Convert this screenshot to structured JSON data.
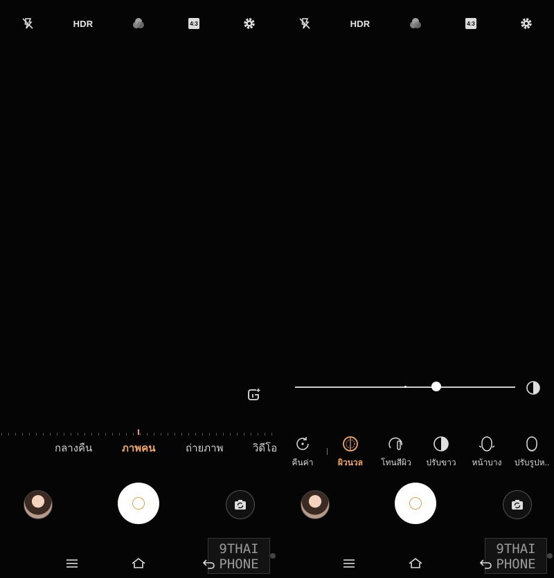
{
  "top_bar": {
    "items": [
      {
        "icon": "flash-off-icon"
      },
      {
        "label": "HDR"
      },
      {
        "icon": "filters-icon"
      },
      {
        "label": "4:3"
      },
      {
        "icon": "settings-gear-icon"
      }
    ]
  },
  "left": {
    "modes": [
      "กลางคืน",
      "ภาพคน",
      "ถ่ายภาพ",
      "วิดีโอ"
    ],
    "active_mode": "ภาพคน"
  },
  "right": {
    "slider": {
      "value": 0.64
    },
    "beauty_options": [
      {
        "label": "คืนค่า",
        "icon": "reset-icon"
      },
      {
        "label": "ผิวนวล",
        "icon": "smooth-skin-icon",
        "active": true
      },
      {
        "label": "โทนสีผิว",
        "icon": "skin-tone-icon"
      },
      {
        "label": "ปรับขาว",
        "icon": "whitening-icon"
      },
      {
        "label": "หน้าบาง",
        "icon": "slim-face-icon"
      },
      {
        "label": "ปรับรูปห..",
        "icon": "face-shape-icon"
      }
    ]
  },
  "watermark": {
    "line1": "9THAI",
    "line2": "PHONE"
  },
  "colors": {
    "accent": "#f2a862",
    "shutter_ring": "#e0a246",
    "background": "#050505"
  }
}
